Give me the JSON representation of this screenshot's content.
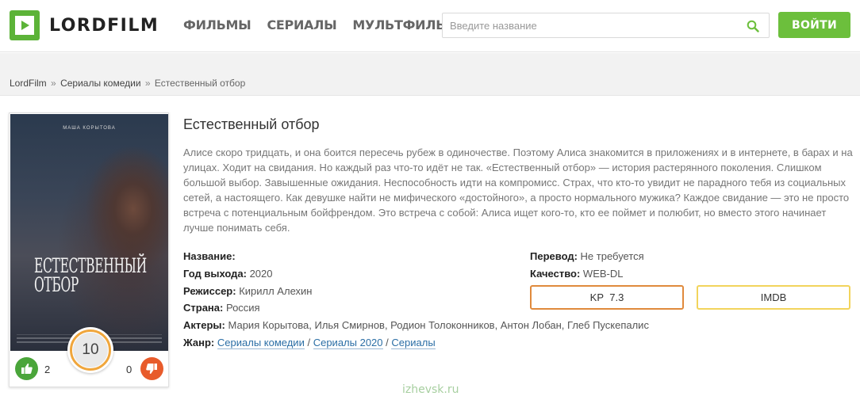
{
  "header": {
    "logo_text": "LORDFILM",
    "nav": [
      "ФИЛЬМЫ",
      "СЕРИАЛЫ",
      "МУЛЬТФИЛЬМЫ"
    ],
    "search_placeholder": "Введите название",
    "login_label": "ВОЙТИ"
  },
  "breadcrumb": {
    "items": [
      "LordFilm",
      "Сериалы комедии"
    ],
    "separator": "»",
    "current": "Естественный отбор"
  },
  "poster": {
    "top_name": "МАША КОРЫТОВА",
    "title_line1": "ЕСТЕСТВЕННЫЙ",
    "title_line2": "ОТБОР",
    "rating": "10",
    "likes": "2",
    "dislikes": "0"
  },
  "movie": {
    "title": "Естественный отбор",
    "description": "Алисе скоро тридцать, и она боится пересечь рубеж в одиночестве. Поэтому Алиса знакомится в приложениях и в интернете, в барах и на улицах. Ходит на свидания. Но каждый раз что-то идёт не так. «Естественный отбор» — история растерянного поколения. Слишком большой выбор. Завышенные ожидания. Неспособность идти на компромисс. Страх, что кто-то увидит не парадного тебя из социальных сетей, а настоящего. Как девушке найти не мифического «достойного», а просто нормального мужика? Каждое свидание — это не просто встреча с потенциальным бойфрендом. Это встреча с собой: Алиса ищет кого-то, кто ее поймет и полюбит, но вместо этого начинает лучше понимать себя."
  },
  "info": {
    "name_label": "Название:",
    "name_value": "",
    "year_label": "Год выхода:",
    "year_value": "2020",
    "director_label": "Режиссер:",
    "director_value": "Кирилл Алехин",
    "country_label": "Страна:",
    "country_value": "Россия",
    "actors_label": "Актеры:",
    "actors_value": "Мария Корытова, Илья Смирнов, Родион Толоконников, Антон Лобан, Глеб Пускепалис",
    "genre_label": "Жанр:",
    "genres": [
      "Сериалы комедии",
      "Сериалы 2020",
      "Сериалы"
    ],
    "genre_sep": "/",
    "translation_label": "Перевод:",
    "translation_value": "Не требуется",
    "quality_label": "Качество:",
    "quality_value": "WEB-DL"
  },
  "ratings": {
    "kp_label": "KP",
    "kp_value": "7.3",
    "imdb_label": "IMDB"
  },
  "watermark": "izhevsk.ru",
  "colors": {
    "accent_green": "#6cbf3c",
    "kp_border": "#e08a3c",
    "imdb_border": "#f2d45c",
    "like": "#4aa53a",
    "dislike": "#e85b2b"
  }
}
